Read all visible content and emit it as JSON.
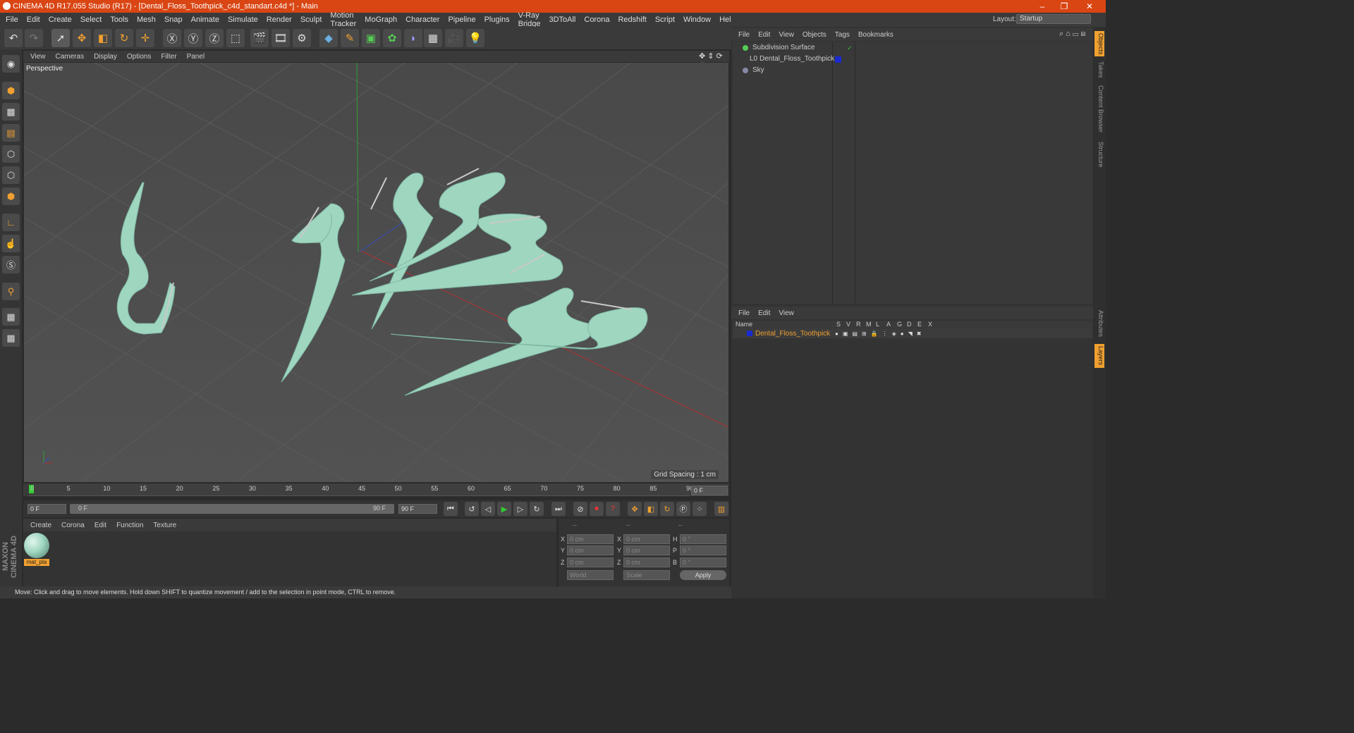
{
  "window": {
    "title": "CINEMA 4D R17.055 Studio (R17) - [Dental_Floss_Toothpick_c4d_standart.c4d *] - Main",
    "controls": [
      "–",
      "❐",
      "✕"
    ]
  },
  "menu": [
    "File",
    "Edit",
    "Create",
    "Select",
    "Tools",
    "Mesh",
    "Snap",
    "Animate",
    "Simulate",
    "Render",
    "Sculpt",
    "Motion Tracker",
    "MoGraph",
    "Character",
    "Pipeline",
    "Plugins",
    "V-Ray Bridge",
    "3DToAll",
    "Corona",
    "Redshift",
    "Script",
    "Window",
    "Help"
  ],
  "layout": {
    "label": "Layout:",
    "value": "Startup"
  },
  "viewport": {
    "menu": [
      "View",
      "Cameras",
      "Display",
      "Options",
      "Filter",
      "Panel"
    ],
    "label": "Perspective",
    "grid_spacing": "Grid Spacing : 1 cm"
  },
  "timeline": {
    "ticks": [
      "0",
      "5",
      "10",
      "15",
      "20",
      "25",
      "30",
      "35",
      "40",
      "45",
      "50",
      "55",
      "60",
      "65",
      "70",
      "75",
      "80",
      "85",
      "90"
    ],
    "current_frame": "0 F"
  },
  "transport": {
    "start": "0 F",
    "range_start": "0 F",
    "range_end": "90 F",
    "end": "90 F"
  },
  "material_manager": {
    "menu": [
      "Create",
      "Corona",
      "Edit",
      "Function",
      "Texture"
    ],
    "material_name": "mat_pla"
  },
  "coordinates": {
    "headers": [
      "--",
      "--",
      "--"
    ],
    "rows": [
      {
        "a": "X",
        "av": "0 cm",
        "b": "X",
        "bv": "0 cm",
        "c": "H",
        "cv": "0 °"
      },
      {
        "a": "Y",
        "av": "0 cm",
        "b": "Y",
        "bv": "0 cm",
        "c": "P",
        "cv": "0 °"
      },
      {
        "a": "Z",
        "av": "0 cm",
        "b": "Z",
        "bv": "0 cm",
        "c": "B",
        "cv": "0 °"
      }
    ],
    "world": "World",
    "scale": "Scale",
    "apply": "Apply"
  },
  "status": "Move: Click and drag to move elements. Hold down SHIFT to quantize movement / add to the selection in point mode, CTRL to remove.",
  "object_manager": {
    "menu": [
      "File",
      "Edit",
      "View",
      "Objects",
      "Tags",
      "Bookmarks"
    ],
    "objects": [
      "Subdivision Surface",
      "Dental_Floss_Toothpick",
      "Sky"
    ]
  },
  "layer_manager": {
    "menu": [
      "File",
      "Edit",
      "View"
    ],
    "columns": [
      "Name",
      "S",
      "V",
      "R",
      "M",
      "L",
      "A",
      "G",
      "D",
      "E",
      "X"
    ],
    "layer": "Dental_Floss_Toothpick"
  },
  "side_tabs": [
    "Objects",
    "Takes",
    "Content Browser",
    "Structure",
    "Attributes",
    "Layers"
  ],
  "brand": "MAXON CINEMA 4D",
  "colors": {
    "accent": "#d94513",
    "model": "#9fd6c0",
    "active_orange": "#f0a030",
    "x_axis": "#b03030",
    "y_axis": "#30a030",
    "z_axis": "#3050c0"
  }
}
